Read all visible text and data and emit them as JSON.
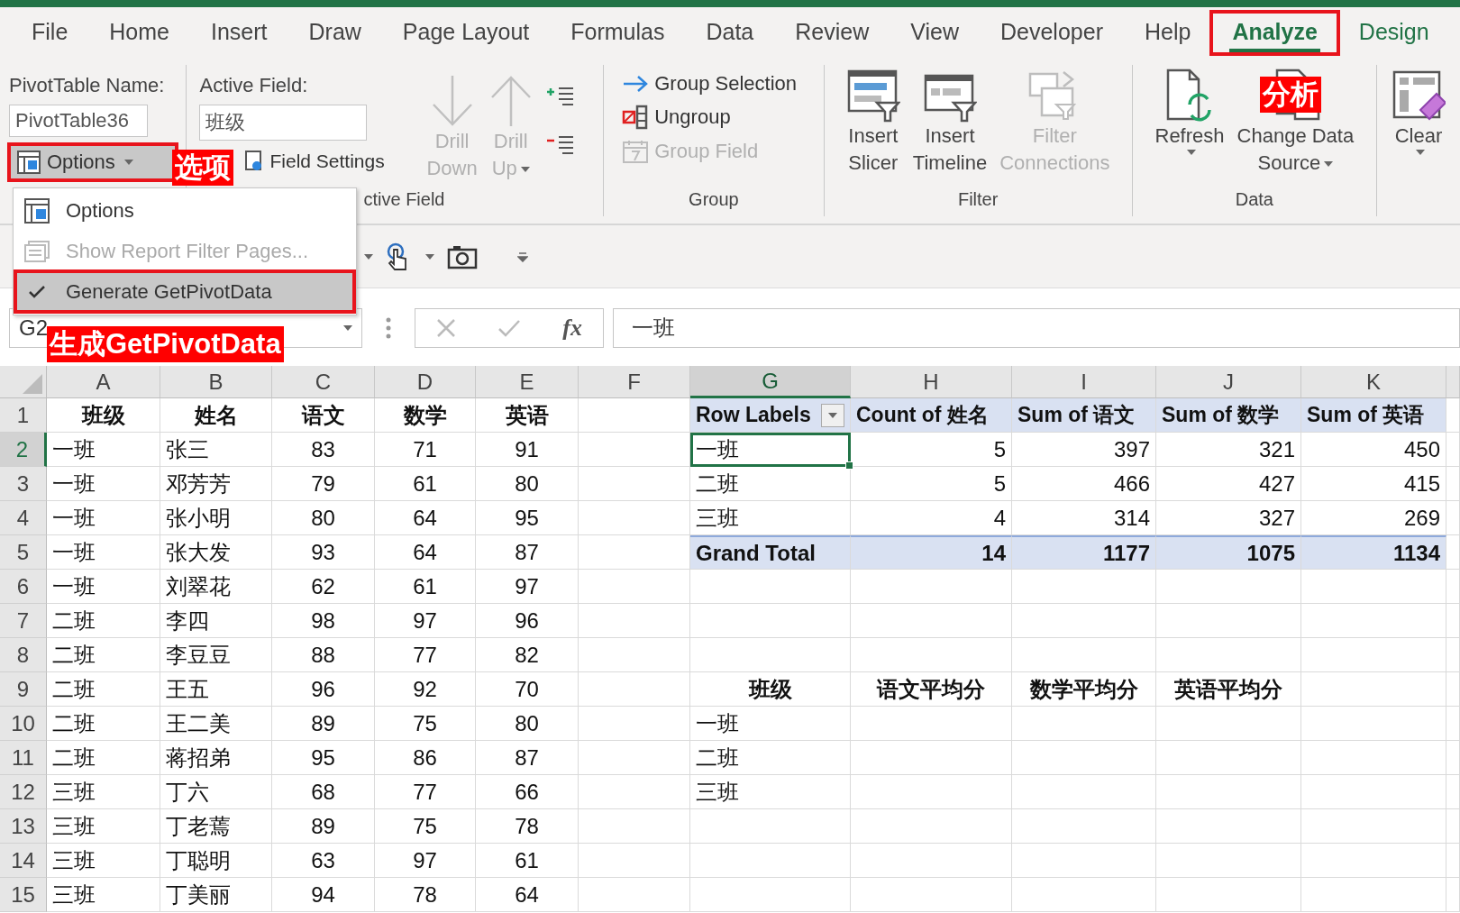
{
  "tabs": [
    {
      "label": "File",
      "selected": false,
      "contextual": false,
      "annotated": false
    },
    {
      "label": "Home",
      "selected": false,
      "contextual": false,
      "annotated": false
    },
    {
      "label": "Insert",
      "selected": false,
      "contextual": false,
      "annotated": false
    },
    {
      "label": "Draw",
      "selected": false,
      "contextual": false,
      "annotated": false
    },
    {
      "label": "Page Layout",
      "selected": false,
      "contextual": false,
      "annotated": false
    },
    {
      "label": "Formulas",
      "selected": false,
      "contextual": false,
      "annotated": false
    },
    {
      "label": "Data",
      "selected": false,
      "contextual": false,
      "annotated": false
    },
    {
      "label": "Review",
      "selected": false,
      "contextual": false,
      "annotated": false
    },
    {
      "label": "View",
      "selected": false,
      "contextual": false,
      "annotated": false
    },
    {
      "label": "Developer",
      "selected": false,
      "contextual": false,
      "annotated": false
    },
    {
      "label": "Help",
      "selected": false,
      "contextual": false,
      "annotated": false
    },
    {
      "label": "Analyze",
      "selected": true,
      "contextual": true,
      "annotated": true
    },
    {
      "label": "Design",
      "selected": false,
      "contextual": true,
      "annotated": false
    }
  ],
  "ribbon": {
    "pivottable": {
      "name_label": "PivotTable Name:",
      "name_value": "PivotTable36",
      "options_button": {
        "label": "Options",
        "expanded": true,
        "annotated": true
      }
    },
    "active_field": {
      "label": "Active Field:",
      "value": "班级",
      "field_settings": "Field Settings",
      "drill_down": {
        "lines": [
          "Drill",
          "Down"
        ],
        "disabled": true,
        "dropdown": false
      },
      "drill_up": {
        "lines": [
          "Drill",
          "Up"
        ],
        "disabled": true,
        "dropdown": true
      },
      "group_label": "ctive Field"
    },
    "group": {
      "items": [
        {
          "kind": "group_selection",
          "label": "Group Selection",
          "disabled": false
        },
        {
          "kind": "ungroup",
          "label": "Ungroup",
          "disabled": false
        },
        {
          "kind": "group_field",
          "label": "Group Field",
          "disabled": true
        }
      ],
      "group_label": "Group"
    },
    "filter": {
      "buttons": [
        {
          "kind": "slicer",
          "lines": [
            "Insert",
            "Slicer"
          ],
          "disabled": false,
          "dropdown": false
        },
        {
          "kind": "timeline",
          "lines": [
            "Insert",
            "Timeline"
          ],
          "disabled": false,
          "dropdown": false
        },
        {
          "kind": "connections",
          "lines": [
            "Filter",
            "Connections"
          ],
          "disabled": true,
          "dropdown": false
        }
      ],
      "group_label": "Filter"
    },
    "data": {
      "buttons": [
        {
          "kind": "refresh",
          "lines": [
            "Refresh"
          ],
          "disabled": false,
          "dropdown": true
        },
        {
          "kind": "change_source",
          "lines": [
            "Change Data",
            "Source"
          ],
          "disabled": false,
          "dropdown": true
        }
      ],
      "group_label": "Data"
    },
    "clear": {
      "kind": "clear",
      "lines": [
        "Clear"
      ],
      "disabled": false,
      "dropdown": true
    }
  },
  "menu": {
    "items": [
      {
        "kind": "options",
        "label": "Options",
        "disabled": false,
        "checked": false,
        "highlighted": false,
        "annotated": false
      },
      {
        "kind": "report_filter",
        "label": "Show Report Filter Pages...",
        "disabled": true,
        "checked": false,
        "highlighted": false,
        "annotated": false
      },
      {
        "label": "Generate GetPivotData",
        "disabled": false,
        "checked": true,
        "highlighted": true,
        "annotated": true
      }
    ]
  },
  "formula_bar": {
    "name_box": "G2",
    "function_label": "fx",
    "formula": "一班"
  },
  "sheet": {
    "columns": [
      {
        "letter": "A",
        "selected": false
      },
      {
        "letter": "B",
        "selected": false
      },
      {
        "letter": "C",
        "selected": false
      },
      {
        "letter": "D",
        "selected": false
      },
      {
        "letter": "E",
        "selected": false
      },
      {
        "letter": "F",
        "selected": false
      },
      {
        "letter": "G",
        "selected": true
      },
      {
        "letter": "H",
        "selected": false
      },
      {
        "letter": "I",
        "selected": false
      },
      {
        "letter": "J",
        "selected": false
      },
      {
        "letter": "K",
        "selected": false
      }
    ],
    "rows": [
      {
        "number": "1",
        "selected": false,
        "kind": "header",
        "cells": {
          "A": "班级",
          "B": "姓名",
          "C": "语文",
          "D": "数学",
          "E": "英语",
          "G": "Row Labels",
          "H": "Count of 姓名",
          "I": "Sum of 语文",
          "J": "Sum of 数学",
          "K": "Sum of 英语"
        }
      },
      {
        "number": "2",
        "selected": true,
        "kind": "pivot_item",
        "cells": {
          "A": "一班",
          "B": "张三",
          "C": "83",
          "D": "71",
          "E": "91",
          "G": "一班",
          "H": "5",
          "I": "397",
          "J": "321",
          "K": "450"
        }
      },
      {
        "number": "3",
        "selected": false,
        "kind": "pivot_item",
        "cells": {
          "A": "一班",
          "B": "邓芳芳",
          "C": "79",
          "D": "61",
          "E": "80",
          "G": "二班",
          "H": "5",
          "I": "466",
          "J": "427",
          "K": "415"
        }
      },
      {
        "number": "4",
        "selected": false,
        "kind": "pivot_item",
        "cells": {
          "A": "一班",
          "B": "张小明",
          "C": "80",
          "D": "64",
          "E": "95",
          "G": "三班",
          "H": "4",
          "I": "314",
          "J": "327",
          "K": "269"
        }
      },
      {
        "number": "5",
        "selected": false,
        "kind": "total",
        "cells": {
          "A": "一班",
          "B": "张大发",
          "C": "93",
          "D": "64",
          "E": "87",
          "G": "Grand Total",
          "H": "14",
          "I": "1177",
          "J": "1075",
          "K": "1134"
        }
      },
      {
        "number": "6",
        "selected": false,
        "kind": "plain",
        "cells": {
          "A": "一班",
          "B": "刘翠花",
          "C": "62",
          "D": "61",
          "E": "97"
        }
      },
      {
        "number": "7",
        "selected": false,
        "kind": "plain",
        "cells": {
          "A": "二班",
          "B": "李四",
          "C": "98",
          "D": "97",
          "E": "96"
        }
      },
      {
        "number": "8",
        "selected": false,
        "kind": "plain",
        "cells": {
          "A": "二班",
          "B": "李豆豆",
          "C": "88",
          "D": "77",
          "E": "82"
        }
      },
      {
        "number": "9",
        "selected": false,
        "kind": "summary_header",
        "cells": {
          "A": "二班",
          "B": "王五",
          "C": "96",
          "D": "92",
          "E": "70",
          "G": "班级",
          "H": "语文平均分",
          "I": "数学平均分",
          "J": "英语平均分"
        }
      },
      {
        "number": "10",
        "selected": false,
        "kind": "plain",
        "cells": {
          "A": "二班",
          "B": "王二美",
          "C": "89",
          "D": "75",
          "E": "80",
          "G": "一班"
        }
      },
      {
        "number": "11",
        "selected": false,
        "kind": "plain",
        "cells": {
          "A": "二班",
          "B": "蒋招弟",
          "C": "95",
          "D": "86",
          "E": "87",
          "G": "二班"
        }
      },
      {
        "number": "12",
        "selected": false,
        "kind": "plain",
        "cells": {
          "A": "三班",
          "B": "丁六",
          "C": "68",
          "D": "77",
          "E": "66",
          "G": "三班"
        }
      },
      {
        "number": "13",
        "selected": false,
        "kind": "plain",
        "cells": {
          "A": "三班",
          "B": "丁老蔫",
          "C": "89",
          "D": "75",
          "E": "78"
        }
      },
      {
        "number": "14",
        "selected": false,
        "kind": "plain",
        "cells": {
          "A": "三班",
          "B": "丁聪明",
          "C": "63",
          "D": "97",
          "E": "61"
        }
      },
      {
        "number": "15",
        "selected": false,
        "kind": "plain",
        "cells": {
          "A": "三班",
          "B": "丁美丽",
          "C": "94",
          "D": "78",
          "E": "64"
        }
      }
    ]
  },
  "annotations": [
    {
      "text": "选项"
    },
    {
      "text": "分析"
    },
    {
      "text": "生成GetPivotData"
    }
  ]
}
